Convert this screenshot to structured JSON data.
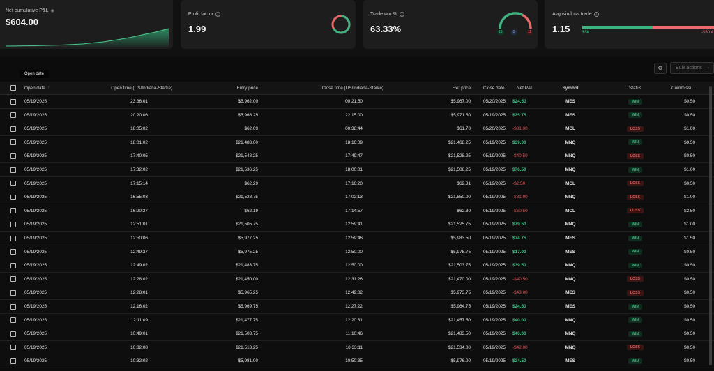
{
  "cards": {
    "net_pnl": {
      "title": "Net cumulative P&L",
      "value": "$604.00"
    },
    "profit_factor": {
      "title": "Profit factor",
      "value": "1.99"
    },
    "trade_win": {
      "title": "Trade win %",
      "value": "63.33%",
      "wins": "19",
      "neutral": "0",
      "losses": "11"
    },
    "avg_win_loss": {
      "title": "Avg win/loss trade",
      "value": "1.15",
      "avg_win": "$58",
      "avg_loss": "-$50.4"
    }
  },
  "tooltip": "Open date",
  "toolbar": {
    "bulk_actions": "Bulk actions"
  },
  "table": {
    "headers": {
      "open_date": "Open date",
      "open_time": "Open time (US/Indiana-Starke)",
      "entry_price": "Entry price",
      "close_time": "Close time (US/Indiana-Starke)",
      "exit_price": "Exit price",
      "close_date": "Close date",
      "net_pnl": "Net P&L",
      "symbol": "Symbol",
      "status": "Status",
      "commission": "Commissi..."
    },
    "rows": [
      {
        "open_date": "05/19/2025",
        "open_time": "23:36:01",
        "entry_price": "$5,962.00",
        "close_time": "00:21:50",
        "exit_price": "$5,967.00",
        "close_date": "05/20/2025",
        "net_pnl": "$24.50",
        "symbol": "MES",
        "status": "WIN",
        "commission": "$0.50"
      },
      {
        "open_date": "05/19/2025",
        "open_time": "20:20:06",
        "entry_price": "$5,966.25",
        "close_time": "22:15:00",
        "exit_price": "$5,971.50",
        "close_date": "05/19/2025",
        "net_pnl": "$25.75",
        "symbol": "MES",
        "status": "WIN",
        "commission": "$0.50"
      },
      {
        "open_date": "05/19/2025",
        "open_time": "18:05:02",
        "entry_price": "$62.09",
        "close_time": "00:38:44",
        "exit_price": "$61.70",
        "close_date": "05/20/2025",
        "net_pnl": "-$81.00",
        "symbol": "MCL",
        "status": "LOSS",
        "commission": "$1.00"
      },
      {
        "open_date": "05/19/2025",
        "open_time": "18:01:02",
        "entry_price": "$21,488.00",
        "close_time": "18:16:09",
        "exit_price": "$21,468.25",
        "close_date": "05/19/2025",
        "net_pnl": "$39.00",
        "symbol": "MNQ",
        "status": "WIN",
        "commission": "$0.50"
      },
      {
        "open_date": "05/19/2025",
        "open_time": "17:40:05",
        "entry_price": "$21,548.25",
        "close_time": "17:49:47",
        "exit_price": "$21,528.25",
        "close_date": "05/19/2025",
        "net_pnl": "-$40.50",
        "symbol": "MNQ",
        "status": "LOSS",
        "commission": "$0.50"
      },
      {
        "open_date": "05/19/2025",
        "open_time": "17:32:02",
        "entry_price": "$21,536.25",
        "close_time": "18:00:01",
        "exit_price": "$21,508.25",
        "close_date": "05/19/2025",
        "net_pnl": "$76.50",
        "symbol": "MNQ",
        "status": "WIN",
        "commission": "$1.00"
      },
      {
        "open_date": "05/19/2025",
        "open_time": "17:15:14",
        "entry_price": "$62.29",
        "close_time": "17:16:20",
        "exit_price": "$62.31",
        "close_date": "05/19/2025",
        "net_pnl": "-$2.50",
        "symbol": "MCL",
        "status": "LOSS",
        "commission": "$0.50"
      },
      {
        "open_date": "05/19/2025",
        "open_time": "16:55:03",
        "entry_price": "$21,528.75",
        "close_time": "17:02:13",
        "exit_price": "$21,550.00",
        "close_date": "05/19/2025",
        "net_pnl": "-$81.00",
        "symbol": "MNQ",
        "status": "LOSS",
        "commission": "$1.00"
      },
      {
        "open_date": "05/19/2025",
        "open_time": "16:20:27",
        "entry_price": "$62.19",
        "close_time": "17:14:57",
        "exit_price": "$62.30",
        "close_date": "05/19/2025",
        "net_pnl": "-$60.50",
        "symbol": "MCL",
        "status": "LOSS",
        "commission": "$2.50"
      },
      {
        "open_date": "05/19/2025",
        "open_time": "12:51:01",
        "entry_price": "$21,505.75",
        "close_time": "12:59:41",
        "exit_price": "$21,525.75",
        "close_date": "05/19/2025",
        "net_pnl": "$79.50",
        "symbol": "MNQ",
        "status": "WIN",
        "commission": "$1.00"
      },
      {
        "open_date": "05/19/2025",
        "open_time": "12:50:06",
        "entry_price": "$5,977.25",
        "close_time": "12:59:46",
        "exit_price": "$5,983.50",
        "close_date": "05/19/2025",
        "net_pnl": "$74.75",
        "symbol": "MES",
        "status": "WIN",
        "commission": "$1.50"
      },
      {
        "open_date": "05/19/2025",
        "open_time": "12:49:37",
        "entry_price": "$5,975.25",
        "close_time": "12:50:00",
        "exit_price": "$5,978.75",
        "close_date": "05/19/2025",
        "net_pnl": "$17.00",
        "symbol": "MES",
        "status": "WIN",
        "commission": "$0.50"
      },
      {
        "open_date": "05/19/2025",
        "open_time": "12:49:02",
        "entry_price": "$21,483.75",
        "close_time": "12:50:00",
        "exit_price": "$21,503.75",
        "close_date": "05/19/2025",
        "net_pnl": "$39.50",
        "symbol": "MNQ",
        "status": "WIN",
        "commission": "$0.50"
      },
      {
        "open_date": "05/19/2025",
        "open_time": "12:28:02",
        "entry_price": "$21,450.00",
        "close_time": "12:31:26",
        "exit_price": "$21,470.00",
        "close_date": "05/19/2025",
        "net_pnl": "-$40.50",
        "symbol": "MNQ",
        "status": "LOSS",
        "commission": "$0.50"
      },
      {
        "open_date": "05/19/2025",
        "open_time": "12:28:01",
        "entry_price": "$5,965.25",
        "close_time": "12:49:02",
        "exit_price": "$5,973.75",
        "close_date": "05/19/2025",
        "net_pnl": "-$43.00",
        "symbol": "MES",
        "status": "LOSS",
        "commission": "$0.50"
      },
      {
        "open_date": "05/19/2025",
        "open_time": "12:16:02",
        "entry_price": "$5,969.75",
        "close_time": "12:27:22",
        "exit_price": "$5,964.75",
        "close_date": "05/19/2025",
        "net_pnl": "$24.50",
        "symbol": "MES",
        "status": "WIN",
        "commission": "$0.50"
      },
      {
        "open_date": "05/19/2025",
        "open_time": "12:11:09",
        "entry_price": "$21,477.75",
        "close_time": "12:20:31",
        "exit_price": "$21,457.50",
        "close_date": "05/19/2025",
        "net_pnl": "$40.00",
        "symbol": "MNQ",
        "status": "WIN",
        "commission": "$0.50"
      },
      {
        "open_date": "05/19/2025",
        "open_time": "10:49:01",
        "entry_price": "$21,503.75",
        "close_time": "11:10:46",
        "exit_price": "$21,483.50",
        "close_date": "05/19/2025",
        "net_pnl": "$40.00",
        "symbol": "MNQ",
        "status": "WIN",
        "commission": "$0.50"
      },
      {
        "open_date": "05/19/2025",
        "open_time": "10:32:08",
        "entry_price": "$21,513.25",
        "close_time": "10:33:11",
        "exit_price": "$21,534.00",
        "close_date": "05/19/2025",
        "net_pnl": "-$42.00",
        "symbol": "MNQ",
        "status": "LOSS",
        "commission": "$0.50"
      },
      {
        "open_date": "05/19/2025",
        "open_time": "10:32:02",
        "entry_price": "$5,981.00",
        "close_time": "10:50:35",
        "exit_price": "$5,976.00",
        "close_date": "05/19/2025",
        "net_pnl": "$24.50",
        "symbol": "MES",
        "status": "WIN",
        "commission": "$0.50"
      }
    ]
  },
  "colors": {
    "win": "#3fc48a",
    "loss": "#e05454",
    "card_bg": "#1d1d1d",
    "page_bg": "#0c0c0c"
  },
  "icons": {
    "info": "info-icon",
    "eye": "eye-icon",
    "settings": "settings-icon",
    "chevron": "chevron-down-icon",
    "sort": "sort-up-icon"
  }
}
